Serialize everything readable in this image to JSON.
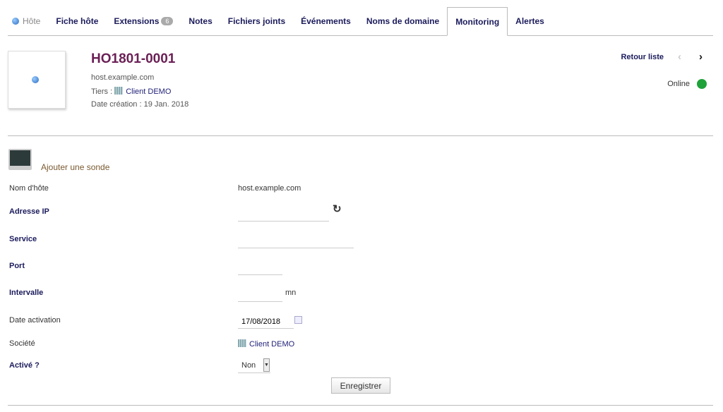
{
  "tabs": {
    "host": "Hôte",
    "card": "Fiche hôte",
    "extensions": "Extensions",
    "extensions_count": "6",
    "notes": "Notes",
    "files": "Fichiers joints",
    "events": "Événements",
    "domains": "Noms de domaine",
    "monitoring": "Monitoring",
    "alerts": "Alertes"
  },
  "header": {
    "ref": "HO1801-0001",
    "hostname": "host.example.com",
    "tiers_label": "Tiers :",
    "tiers": "Client DEMO",
    "created": "Date création : 19 Jan. 2018",
    "back": "Retour liste",
    "prev": "‹",
    "next": "›",
    "status": "Online",
    "status_color": "#1fa23a"
  },
  "form": {
    "title": "Ajouter une sonde",
    "hostname_label": "Nom d'hôte",
    "hostname": "host.example.com",
    "ip_label": "Adresse IP",
    "ip": "",
    "service_label": "Service",
    "service": "",
    "port_label": "Port",
    "port": "",
    "interval_label": "Intervalle",
    "interval": "",
    "interval_unit": "mn",
    "date_label": "Date activation",
    "date": "17/08/2018",
    "company_label": "Société",
    "company": "Client DEMO",
    "active_label": "Activé ?",
    "active": "Non",
    "save": "Enregistrer"
  }
}
